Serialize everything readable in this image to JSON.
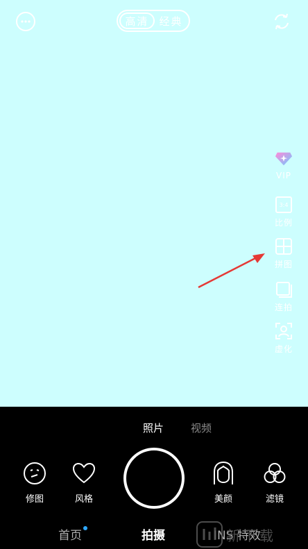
{
  "top_bar": {
    "quality": {
      "options": [
        "高清",
        "经典"
      ],
      "selected_index": 0
    },
    "more_icon": "more-icon",
    "switch_camera_icon": "switch-camera-icon"
  },
  "right_tools": [
    {
      "label": "VIP",
      "icon": "vip-diamond-icon"
    },
    {
      "label": "比例",
      "icon": "ratio-icon"
    },
    {
      "label": "拼图",
      "icon": "collage-icon"
    },
    {
      "label": "连拍",
      "icon": "burst-icon"
    },
    {
      "label": "虚化",
      "icon": "blur-icon"
    }
  ],
  "capture_modes": {
    "items": [
      "照片",
      "视频"
    ],
    "selected_index": 0
  },
  "bottom_tools": [
    {
      "label": "修图",
      "icon": "edit-face-icon"
    },
    {
      "label": "风格",
      "icon": "heart-icon"
    },
    {
      "label": "美颜",
      "icon": "beauty-face-icon"
    },
    {
      "label": "滤镜",
      "icon": "filter-circles-icon"
    }
  ],
  "bottom_nav": {
    "items": [
      "首页",
      "拍摄",
      "INS 特效"
    ],
    "selected_index": 1,
    "badge_on_index": 0
  },
  "watermark": {
    "text": "新下载"
  },
  "colors": {
    "viewfinder_bg": "#cdfefe",
    "panel_bg": "#000000",
    "accent_dot": "#2ea8ff",
    "annotation_arrow": "#e53935",
    "vip_gradient_start": "#ff8ad8",
    "vip_gradient_end": "#6ec8ff"
  }
}
